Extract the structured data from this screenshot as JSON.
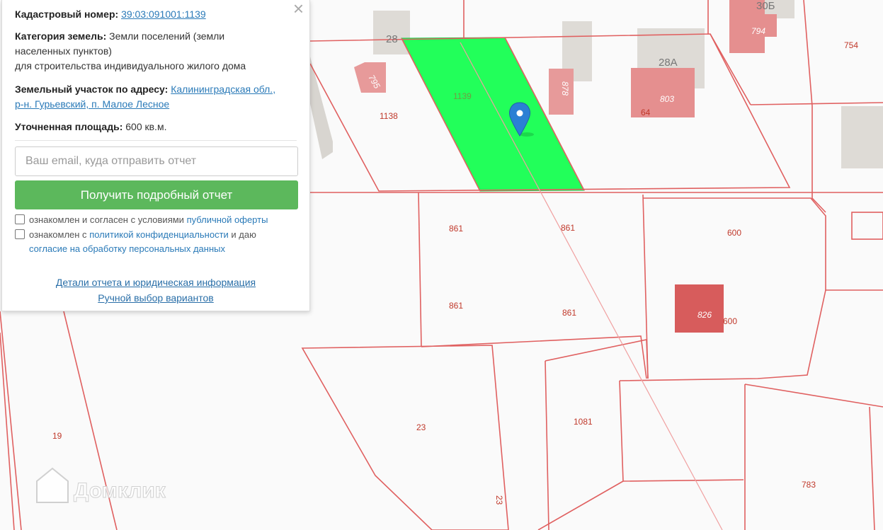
{
  "panel": {
    "close_icon": "×",
    "cadastral_label": "Кадастровый номер:",
    "cadastral_value": "39:03:091001:1139",
    "category_label": "Категория земель:",
    "category_text_1": "Земли поселений (земли",
    "category_text_2": "населенных пунктов)",
    "category_text_3": "для строительства индивидуального жилого дома",
    "address_label": "Земельный участок по адресу:",
    "address_line_1": "Калининградская обл.,",
    "address_line_2": "р-н. Гурьевский, п. Малое Лесное",
    "area_label": "Уточненная площадь:",
    "area_value": "600 кв.м.",
    "email_placeholder": "Ваш email, куда отправить отчет",
    "submit_label": "Получить подробный отчет",
    "consent1_text": "ознакомлен и согласен с условиями",
    "consent1_link": "публичной оферты",
    "consent2_text_a": "ознакомлен с",
    "consent2_link_a": "политикой конфиденциальности",
    "consent2_text_b": "и даю",
    "consent2_link_b": "согласие на обработку персональных данных",
    "details_link": "Детали отчета и юридическая информация",
    "manual_link": "Ручной выбор вариантов"
  },
  "map": {
    "highlight_color": "#22ff5a",
    "boundary_color": "#e06060",
    "marker_icon": "map-pin-icon",
    "house_numbers": [
      "28",
      "28А",
      "30Б"
    ],
    "building_labels": [
      "795",
      "878",
      "803",
      "794",
      "826"
    ],
    "plot_labels": [
      "1139",
      "1138",
      "754",
      "64",
      "861",
      "861",
      "861",
      "861",
      "600",
      "600",
      "19",
      "23",
      "23",
      "1081",
      "783"
    ],
    "watermark": "Домклик"
  }
}
